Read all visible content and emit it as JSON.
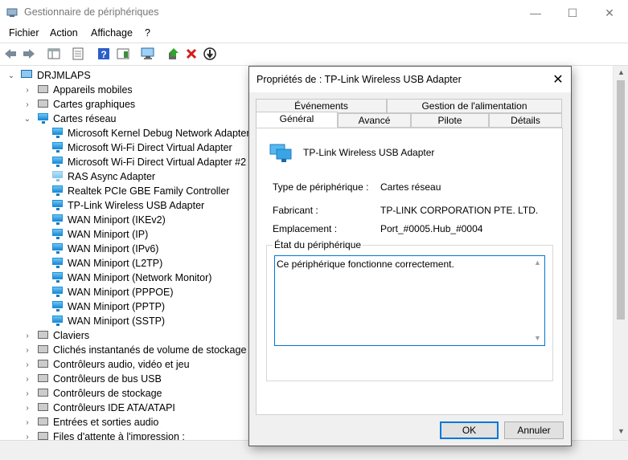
{
  "window": {
    "title": "Gestionnaire de périphériques",
    "minimize": "—",
    "maximize": "☐",
    "close": "✕"
  },
  "menu": [
    "Fichier",
    "Action",
    "Affichage",
    "?"
  ],
  "tree": {
    "root": "DRJMLAPS",
    "items": [
      {
        "label": "Appareils mobiles",
        "expanded": false
      },
      {
        "label": "Cartes graphiques",
        "expanded": false
      },
      {
        "label": "Cartes réseau",
        "expanded": true
      },
      {
        "label": "Microsoft Kernel Debug Network Adapter"
      },
      {
        "label": "Microsoft Wi-Fi Direct Virtual Adapter"
      },
      {
        "label": "Microsoft Wi-Fi Direct Virtual Adapter #2"
      },
      {
        "label": "RAS Async Adapter"
      },
      {
        "label": "Realtek PCIe GBE Family Controller"
      },
      {
        "label": "TP-Link Wireless USB Adapter"
      },
      {
        "label": "WAN Miniport (IKEv2)"
      },
      {
        "label": "WAN Miniport (IP)"
      },
      {
        "label": "WAN Miniport (IPv6)"
      },
      {
        "label": "WAN Miniport (L2TP)"
      },
      {
        "label": "WAN Miniport (Network Monitor)"
      },
      {
        "label": "WAN Miniport (PPPOE)"
      },
      {
        "label": "WAN Miniport (PPTP)"
      },
      {
        "label": "WAN Miniport (SSTP)"
      },
      {
        "label": "Claviers",
        "expanded": false
      },
      {
        "label": "Clichés instantanés de volume de stockage",
        "expanded": false
      },
      {
        "label": "Contrôleurs audio, vidéo et jeu",
        "expanded": false
      },
      {
        "label": "Contrôleurs de bus USB",
        "expanded": false
      },
      {
        "label": "Contrôleurs de stockage",
        "expanded": false
      },
      {
        "label": "Contrôleurs IDE ATA/ATAPI",
        "expanded": false
      },
      {
        "label": "Entrées et sorties audio",
        "expanded": false
      },
      {
        "label": "Files d'attente à l'impression :",
        "expanded": false
      }
    ]
  },
  "dialog": {
    "title": "Propriétés de : TP-Link Wireless USB Adapter",
    "tabs_top": [
      "Événements",
      "Gestion de l'alimentation"
    ],
    "tabs_bottom": [
      "Général",
      "Avancé",
      "Pilote",
      "Détails"
    ],
    "selected_tab": "Général",
    "device_name": "TP-Link Wireless USB Adapter",
    "props": [
      {
        "label": "Type de périphérique :",
        "value": "Cartes réseau"
      },
      {
        "label": "Fabricant :",
        "value": "TP-LINK CORPORATION PTE. LTD."
      },
      {
        "label": "Emplacement :",
        "value": "Port_#0005.Hub_#0004"
      }
    ],
    "status_group": "État du périphérique",
    "status_text": "Ce périphérique fonctionne correctement.",
    "ok": "OK",
    "cancel": "Annuler"
  }
}
